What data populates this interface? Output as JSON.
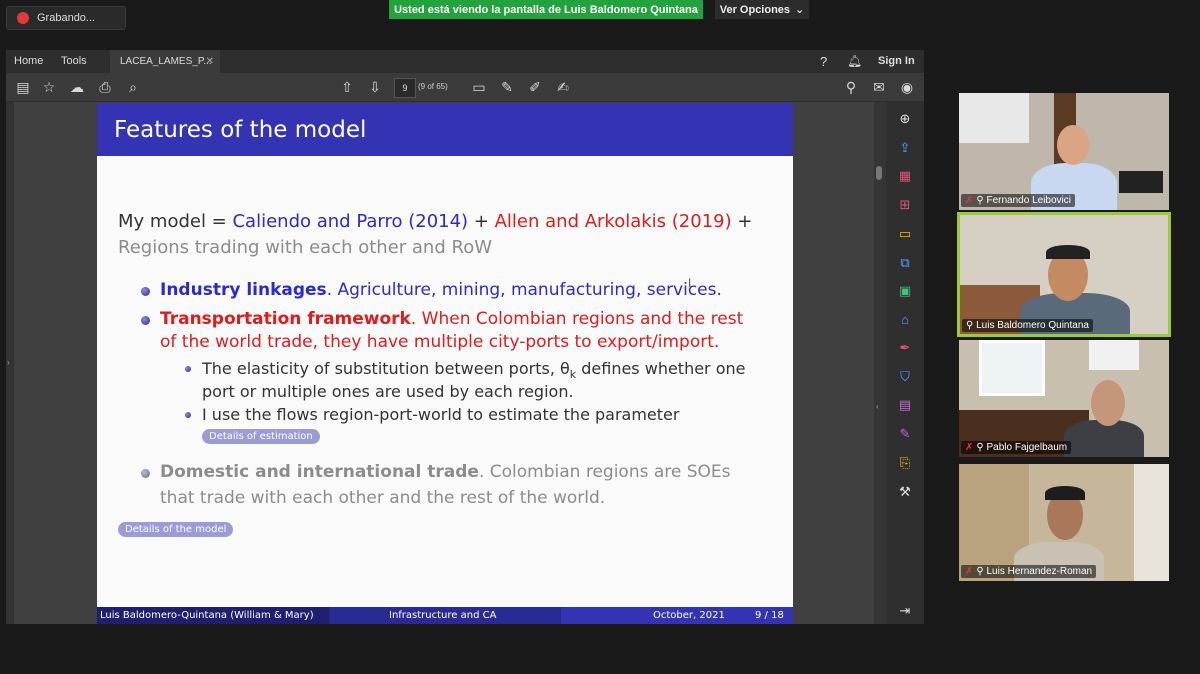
{
  "zoom": {
    "recording_label": "Grabando...",
    "banner_text": "Usted está viendo la pantalla de Luis Baldomero Quintana",
    "view_options_label": "Ver Opciones"
  },
  "acrobat": {
    "menu": {
      "home": "Home",
      "tools": "Tools",
      "sign_in": "Sign In"
    },
    "tab_title": "LACEA_LAMES_P...",
    "page_number": "9",
    "page_count": "(9 of 65)"
  },
  "slide": {
    "title": "Features of the model",
    "intro": {
      "prefix": "My model = ",
      "ref1": "Caliendo and Parro (2014)",
      "plus1": " + ",
      "ref2": "Allen and Arkolakis (2019)",
      "plus2": " +",
      "line2": "Regions trading with each other and RoW"
    },
    "b1": {
      "bold": "Industry linkages",
      "rest": ". Agriculture, mining, manufacturing, services."
    },
    "b2": {
      "bold": "Transportation framework",
      "rest1": ". When Colombian regions and the rest",
      "rest2": "of the world trade, they have multiple city-ports to export/import."
    },
    "s1": {
      "line1": "The elasticity of substitution between ports, θ",
      "sub": "k",
      "line1b": " defines whether one",
      "line2": "port or multiple ones are used by each region."
    },
    "s2": {
      "line1": "I use the flows region-port-world to estimate the parameter"
    },
    "details_estimation": "Details of estimation",
    "b3": {
      "bold": "Domestic and international trade",
      "rest1": ". Colombian regions are SOEs",
      "rest2": "that trade with each other and the rest of the world."
    },
    "details_model": "Details of the model",
    "footer": {
      "author": "Luis Baldomero-Quintana  (William & Mary)",
      "talk": "Infrastructure and CA",
      "date": "October, 2021",
      "page": "9 / 18"
    }
  },
  "participants": [
    {
      "name": "Fernando Leibovici"
    },
    {
      "name": "Luis Baldomero Quintana"
    },
    {
      "name": "Pablo Fajgelbaum"
    },
    {
      "name": "Luis Hernandez-Roman"
    }
  ],
  "colors": {
    "slide_header": "#3333b3",
    "link_blue": "#2a2ad0",
    "highlight_red": "#e01b1b",
    "sharing_green": "#23a33d",
    "active_speaker": "#9acd32"
  }
}
